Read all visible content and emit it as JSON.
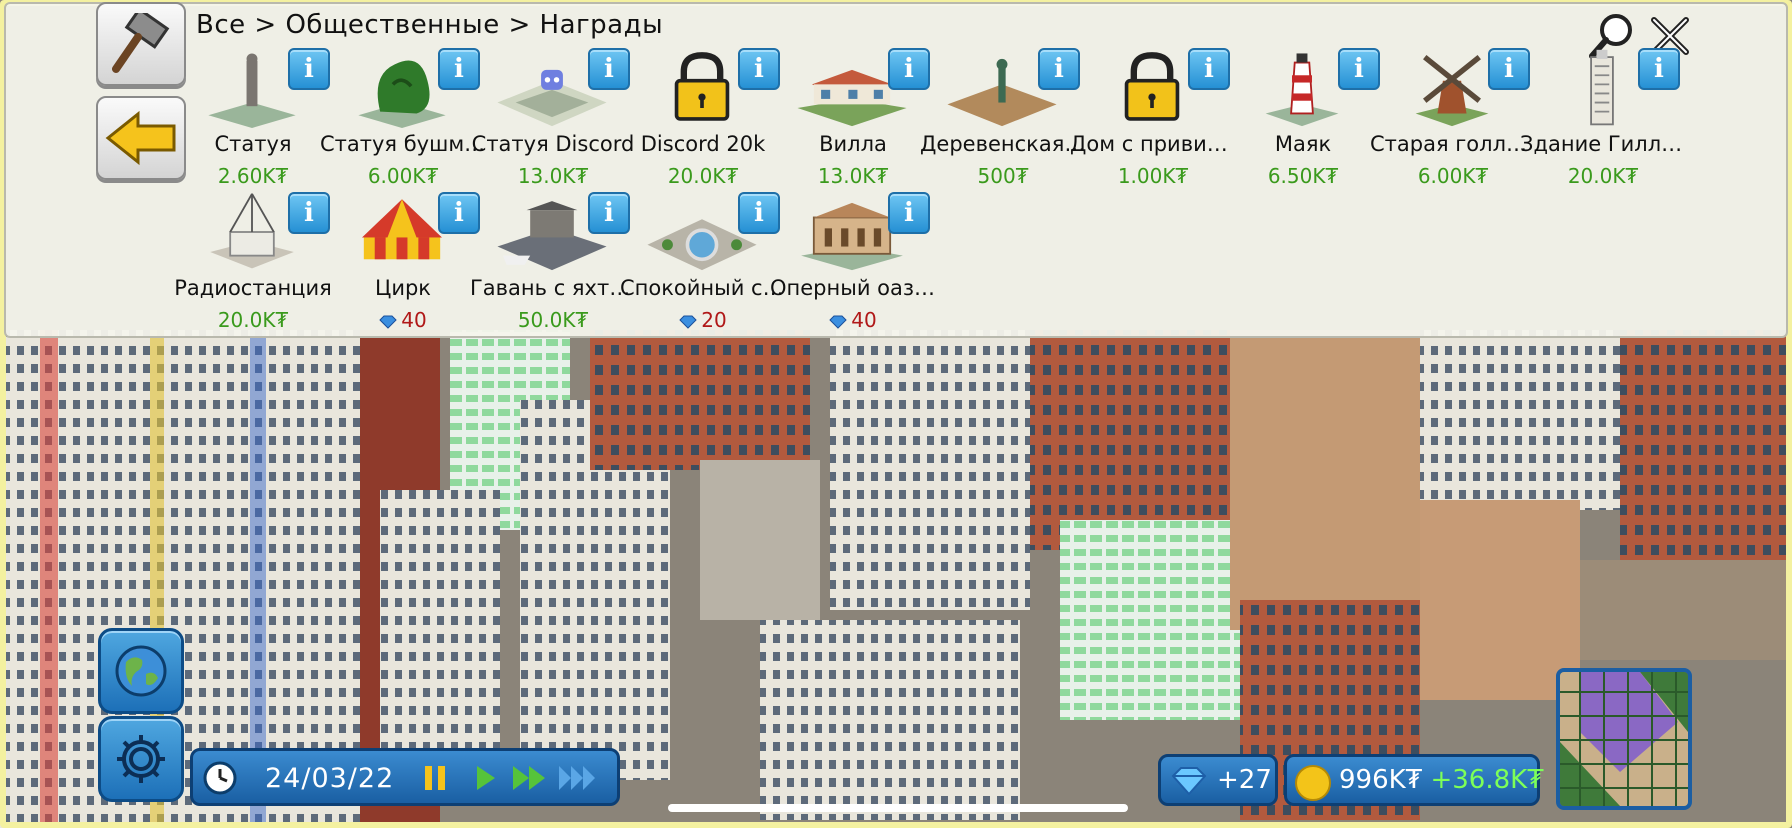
{
  "breadcrumb": "Все > Общественные > Награды",
  "items": [
    {
      "name": "Статуя",
      "price": "2.60K₮",
      "currency": "money",
      "locked": false,
      "icon": "statue-icon"
    },
    {
      "name": "Статуя бушмена",
      "price": "6.00K₮",
      "currency": "money",
      "locked": false,
      "icon": "bush-statue-icon"
    },
    {
      "name": "Статуя Discord",
      "price": "13.0K₮",
      "currency": "money",
      "locked": false,
      "icon": "discord-statue-icon"
    },
    {
      "name": "Discord 20k",
      "price": "20.0K₮",
      "currency": "money",
      "locked": true,
      "icon": "lock-icon"
    },
    {
      "name": "Вилла",
      "price": "13.0K₮",
      "currency": "money",
      "locked": false,
      "icon": "villa-icon"
    },
    {
      "name": "Деревенская п...",
      "price": "500₮",
      "currency": "money",
      "locked": false,
      "icon": "village-plaza-icon"
    },
    {
      "name": "Дом с привиде...",
      "price": "1.00K₮",
      "currency": "money",
      "locked": true,
      "icon": "lock-icon"
    },
    {
      "name": "Маяк",
      "price": "6.50K₮",
      "currency": "money",
      "locked": false,
      "icon": "lighthouse-icon"
    },
    {
      "name": "Старая голлан...",
      "price": "6.00K₮",
      "currency": "money",
      "locked": false,
      "icon": "windmill-icon"
    },
    {
      "name": "Здание Гилле...",
      "price": "20.0K₮",
      "currency": "money",
      "locked": false,
      "icon": "tower-icon"
    },
    {
      "name": "Радиостанция",
      "price": "20.0K₮",
      "currency": "money",
      "locked": false,
      "icon": "radio-station-icon"
    },
    {
      "name": "Цирк",
      "price": "40",
      "currency": "diamond",
      "locked": false,
      "icon": "circus-icon"
    },
    {
      "name": "Гавань с яхтами",
      "price": "50.0K₮",
      "currency": "money",
      "locked": false,
      "icon": "harbor-icon"
    },
    {
      "name": "Спокойный си...",
      "price": "20",
      "currency": "diamond",
      "locked": false,
      "icon": "calm-square-icon"
    },
    {
      "name": "Оперный оазис",
      "price": "40",
      "currency": "diamond",
      "locked": false,
      "icon": "opera-icon"
    }
  ],
  "info_label": "i",
  "date": "24/03/22",
  "gems": "+27",
  "money": "996K₮",
  "income": "+36.8K₮",
  "colors": {
    "price_money": "#3a9a1c",
    "price_diamond": "#b01818",
    "button_blue": "#1d70b8",
    "panel_bg": "#f4f4ec"
  }
}
